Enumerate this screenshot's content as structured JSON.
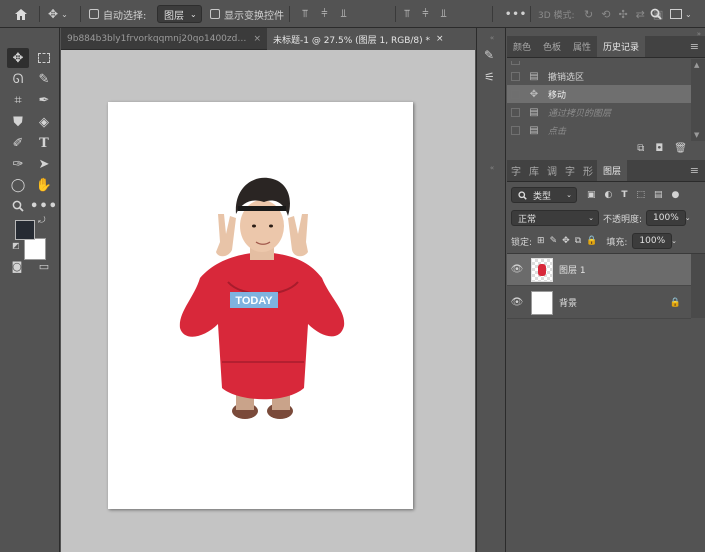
{
  "options_bar": {
    "home_icon": "home-icon",
    "move_icon": "move-icon",
    "auto_select_label": "自动选择:",
    "auto_select_value": "图层",
    "transform_controls_label": "显示变换控件",
    "more_icon": "•••",
    "mode_3d_label": "3D 模式:"
  },
  "tabs": [
    {
      "label": "9b884b3bly1frvorkqqmnj20qo1400zd.jpg",
      "close": "×"
    },
    {
      "label": "未标题-1 @ 27.5% (图层 1, RGB/8) *",
      "close": "×"
    }
  ],
  "toolbar": {
    "tools": [
      "move-tool",
      "marquee-tool",
      "lasso-tool",
      "quick-select-tool",
      "eyedropper-tool",
      "brush-tool",
      "stamp-tool",
      "eraser-tool",
      "history-brush-tool",
      "type-tool",
      "pen-tool",
      "path-select-tool",
      "ellipse-tool",
      "hand-tool",
      "zoom-tool",
      "more-tools"
    ],
    "foreground_color": "#262b33",
    "background_color": "#ffffff"
  },
  "history_panel": {
    "tabs": [
      "颜色",
      "色板",
      "属性",
      "历史记录"
    ],
    "active_tab": "历史记录",
    "items": [
      {
        "label": "撤销选区",
        "state": "normal"
      },
      {
        "label": "移动",
        "state": "active"
      },
      {
        "label": "通过拷贝的图层",
        "state": "undone"
      },
      {
        "label": "点击",
        "state": "undone"
      }
    ]
  },
  "layers_panel": {
    "tabs": [
      "字",
      "库",
      "调",
      "字",
      "形",
      "图层"
    ],
    "active_tab": "图层",
    "filter_label": "类型",
    "blend_mode": "正常",
    "opacity_label": "不透明度:",
    "opacity_value": "100%",
    "lock_label": "锁定:",
    "fill_label": "填充:",
    "fill_value": "100%",
    "layers": [
      {
        "name": "图层 1",
        "active": true
      },
      {
        "name": "背景",
        "active": false,
        "locked": true
      }
    ]
  },
  "colors": {
    "accent_hoodie": "#d8283a",
    "canvas_bg": "#c4c4c4",
    "ui_bg": "#535353"
  }
}
